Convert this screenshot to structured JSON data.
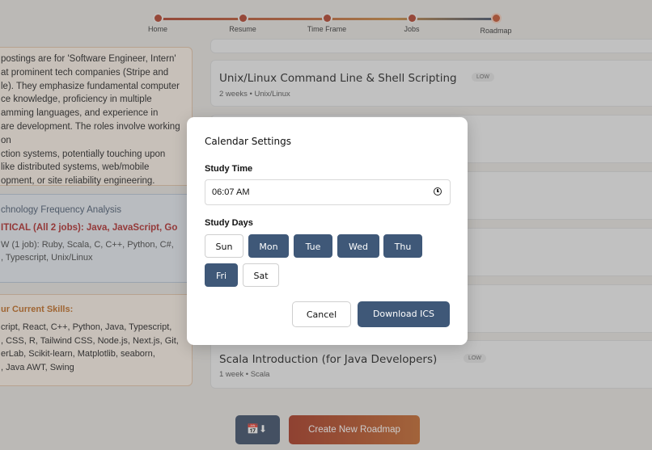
{
  "stepper": {
    "steps": [
      {
        "label": "Home"
      },
      {
        "label": "Resume"
      },
      {
        "label": "Time Frame"
      },
      {
        "label": "Jobs"
      },
      {
        "label": "Roadmap"
      }
    ]
  },
  "summary": {
    "lines": [
      "postings are for 'Software Engineer, Intern'",
      "at prominent tech companies (Stripe and",
      "le). They emphasize fundamental computer",
      "ce knowledge, proficiency in multiple",
      "amming languages, and experience in",
      "are development. The roles involve working on",
      "ction systems, potentially touching upon",
      "like distributed systems, web/mobile",
      "opment, or site reliability engineering."
    ]
  },
  "tech": {
    "title": "chnology Frequency Analysis",
    "critical": "ITICAL (All 2 jobs): Java, JavaScript, Go",
    "low_lines": [
      "W (1 job): Ruby, Scala, C, C++, Python, C#,",
      ", Typescript, Unix/Linux"
    ]
  },
  "skills": {
    "title": "ur Current Skills:",
    "lines": [
      "cript, React, C++, Python, Java, Typescript,",
      ", CSS, R, Tailwind CSS, Node.js, Next.js, Git,",
      "erLab, Scikit-learn, Matplotlib, seaborn,",
      ", Java AWT, Swing"
    ]
  },
  "roadmap": {
    "items": [
      {
        "title": "Unix/Linux Command Line & Shell Scripting",
        "sub": "2 weeks • Unix/Linux",
        "badge": "LOW"
      },
      {
        "title": "Scala Introduction (for Java Developers)",
        "sub": "1 week • Scala",
        "badge": "LOW"
      }
    ]
  },
  "bottom": {
    "create_label": "Create New Roadmap"
  },
  "modal": {
    "title": "Calendar Settings",
    "study_time_label": "Study Time",
    "study_time_value": "06:07 AM",
    "study_days_label": "Study Days",
    "days": [
      {
        "label": "Sun",
        "selected": false
      },
      {
        "label": "Mon",
        "selected": true
      },
      {
        "label": "Tue",
        "selected": true
      },
      {
        "label": "Wed",
        "selected": true
      },
      {
        "label": "Thu",
        "selected": true
      },
      {
        "label": "Fri",
        "selected": true
      },
      {
        "label": "Sat",
        "selected": false
      }
    ],
    "cancel_label": "Cancel",
    "download_label": "Download ICS"
  },
  "colors": {
    "primary": "#3f5878",
    "accent": "#c4532e"
  }
}
